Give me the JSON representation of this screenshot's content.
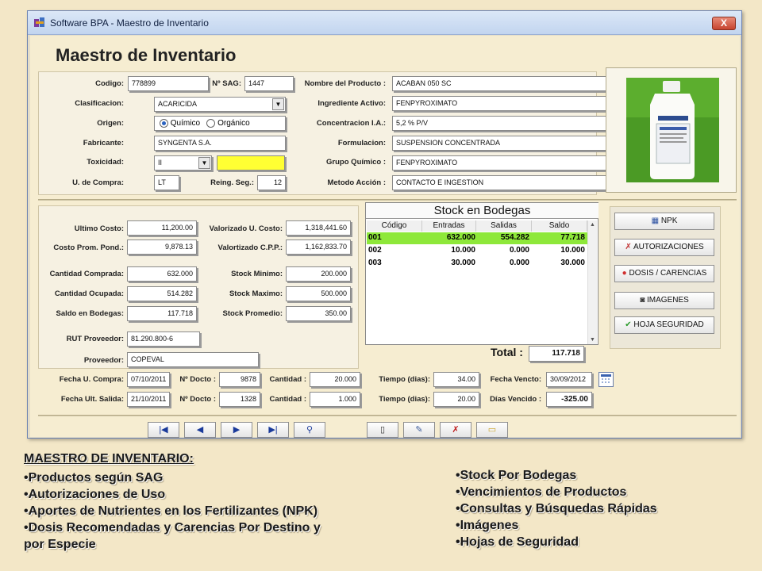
{
  "window": {
    "title": "Software BPA - Maestro de Inventario",
    "close_label": "X"
  },
  "page_title": "Maestro de Inventario",
  "product": {
    "codigo_label": "Codigo:",
    "codigo": "778899",
    "nsag_label": "Nº SAG:",
    "nsag": "1447",
    "clasificacion_label": "Clasificacion:",
    "clasificacion": "ACARICIDA",
    "origen_label": "Origen:",
    "origen_options": [
      "Químico",
      "Orgánico"
    ],
    "fabricante_label": "Fabricante:",
    "fabricante": "SYNGENTA S.A.",
    "toxicidad_label": "Toxicidad:",
    "toxicidad": "II",
    "toxicidad_color": "#ffff33",
    "ucompra_label": "U. de Compra:",
    "ucompra": "LT",
    "reing_label": "Reing. Seg.:",
    "reing": "12",
    "nombre_label": "Nombre del Producto :",
    "nombre": "ACABAN 050 SC",
    "ingrediente_label": "Ingrediente Activo:",
    "ingrediente": "FENPYROXIMATO",
    "concentracion_label": "Concentracion I.A.:",
    "concentracion": "5,2 % P/V",
    "formulacion_label": "Formulacion:",
    "formulacion": "SUSPENSION CONCENTRADA",
    "grupo_label": "Grupo Químico :",
    "grupo": "FENPYROXIMATO",
    "metodo_label": "Metodo Acción :",
    "metodo": "CONTACTO E INGESTION"
  },
  "costs": {
    "ultimo_costo_label": "Ultimo Costo:",
    "ultimo_costo": "11,200.00",
    "costo_prom_label": "Costo Prom. Pond.:",
    "costo_prom": "9,878.13",
    "val_u_label": "Valorizado U. Costo:",
    "val_u": "1,318,441.60",
    "val_cpp_label": "Valortizado C.P.P.:",
    "val_cpp": "1,162,833.70",
    "cant_comprada_label": "Cantidad Comprada:",
    "cant_comprada": "632.000",
    "cant_ocupada_label": "Cantidad Ocupada:",
    "cant_ocupada": "514.282",
    "saldo_label": "Saldo en Bodegas:",
    "saldo": "117.718",
    "stock_min_label": "Stock Minimo:",
    "stock_min": "200.000",
    "stock_max_label": "Stock Maximo:",
    "stock_max": "500.000",
    "stock_prom_label": "Stock Promedio:",
    "stock_prom": "350.00",
    "rut_label": "RUT Proveedor:",
    "rut": "81.290.800-6",
    "proveedor_label": "Proveedor:",
    "proveedor": "COPEVAL"
  },
  "stock": {
    "title": "Stock en Bodegas",
    "headers": [
      "Código",
      "Entradas",
      "Salidas",
      "Saldo"
    ],
    "rows": [
      {
        "codigo": "001",
        "entradas": "632.000",
        "salidas": "554.282",
        "saldo": "77.718"
      },
      {
        "codigo": "002",
        "entradas": "10.000",
        "salidas": "0.000",
        "saldo": "10.000"
      },
      {
        "codigo": "003",
        "entradas": "30.000",
        "salidas": "0.000",
        "saldo": "30.000"
      }
    ],
    "total_label": "Total :",
    "total": "117.718",
    "highlight_color": "#8ee83a"
  },
  "dates": {
    "fecha_compra_label": "Fecha U. Compra:",
    "fecha_compra": "07/10/2011",
    "ndocto_label": "Nº Docto :",
    "ndocto1": "9878",
    "ndocto2": "1328",
    "cantidad_label": "Cantidad :",
    "cantidad1": "20.000",
    "cantidad2": "1.000",
    "tiempo_label": "Tiempo (dias):",
    "tiempo1": "34.00",
    "tiempo2": "20.00",
    "fecha_vencto_label": "Fecha Vencto:",
    "fecha_vencto": "30/09/2012",
    "fecha_salida_label": "Fecha Ult. Salida:",
    "fecha_salida": "21/10/2011",
    "dias_vencido_label": "Días Vencido :",
    "dias_vencido": "-325.00"
  },
  "side_buttons": [
    {
      "label": "NPK",
      "icon": "npk-icon"
    },
    {
      "label": "AUTORIZACIONES",
      "icon": "authorizations-icon"
    },
    {
      "label": "DOSIS / CARENCIAS",
      "icon": "dosage-icon"
    },
    {
      "label": "IMAGENES",
      "icon": "camera-icon"
    },
    {
      "label": "HOJA SEGURIDAD",
      "icon": "checkmark-icon"
    }
  ],
  "nav_icons": [
    "first-record-icon",
    "previous-record-icon",
    "next-record-icon",
    "last-record-icon",
    "search-icon",
    "new-icon",
    "edit-icon",
    "delete-icon",
    "folder-icon"
  ],
  "slide": {
    "heading": "MAESTRO DE INVENTARIO:",
    "left_bullets": [
      "Productos según SAG",
      "Autorizaciones de Uso",
      "Aportes de Nutrientes en los Fertilizantes (NPK)",
      "Dosis Recomendadas y Carencias Por Destino y",
      "por Especie"
    ],
    "right_bullets": [
      "Stock Por Bodegas",
      "Vencimientos de Productos",
      "Consultas y Búsquedas Rápidas",
      "Imágenes",
      "Hojas de Seguridad"
    ]
  }
}
